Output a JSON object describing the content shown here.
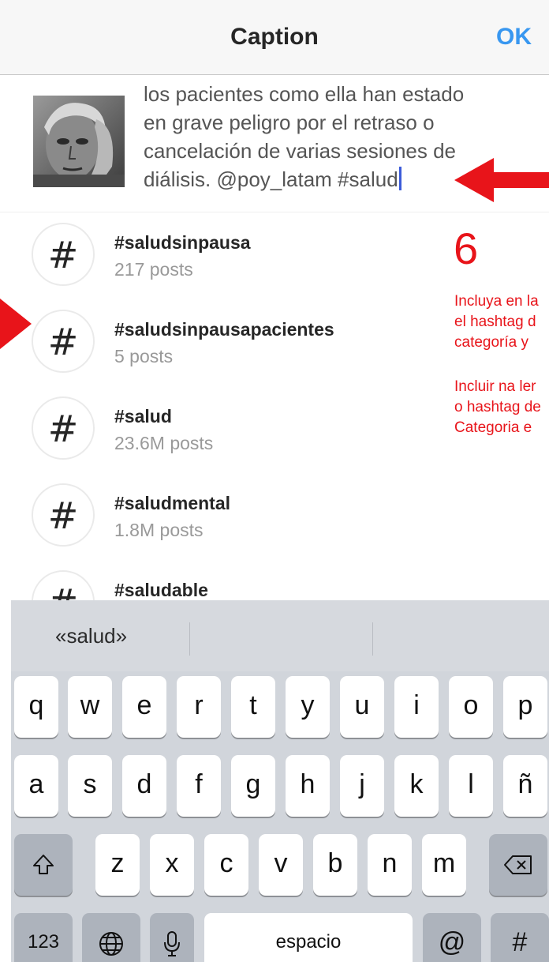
{
  "nav": {
    "title": "Caption",
    "ok_label": "OK"
  },
  "caption": {
    "text": "los pacientes como ella han estado\nen grave peligro por el retraso o\ncancelación de varias sesiones de\ndiálisis. @poy_latam #salud"
  },
  "hashtags": [
    {
      "tag": "#saludsinpausa",
      "count": "217 posts"
    },
    {
      "tag": "#saludsinpausapacientes",
      "count": "5 posts"
    },
    {
      "tag": "#salud",
      "count": "23.6M posts"
    },
    {
      "tag": "#saludmental",
      "count": "1.8M posts"
    },
    {
      "tag": "#saludable",
      "count": ""
    }
  ],
  "hash_symbol": "#",
  "annotation": {
    "step": "6",
    "es_lines": [
      "Incluya en la",
      "el hashtag d",
      "categoría y"
    ],
    "pt_lines": [
      "Incluir na ler",
      "o hashtag de",
      "Categoria e"
    ],
    "color": "#e8141a"
  },
  "keyboard": {
    "prediction": "«salud»",
    "row1": [
      "q",
      "w",
      "e",
      "r",
      "t",
      "y",
      "u",
      "i",
      "o",
      "p"
    ],
    "row2": [
      "a",
      "s",
      "d",
      "f",
      "g",
      "h",
      "j",
      "k",
      "l",
      "ñ"
    ],
    "row3": [
      "z",
      "x",
      "c",
      "v",
      "b",
      "n",
      "m"
    ],
    "numbers_label": "123",
    "space_label": "espacio",
    "at_label": "@",
    "hash_label": "#",
    "icons": [
      "shift-icon",
      "backspace-icon",
      "globe-icon",
      "microphone-icon"
    ]
  },
  "colors": {
    "accent": "#3897f0",
    "annotation": "#e8141a"
  }
}
